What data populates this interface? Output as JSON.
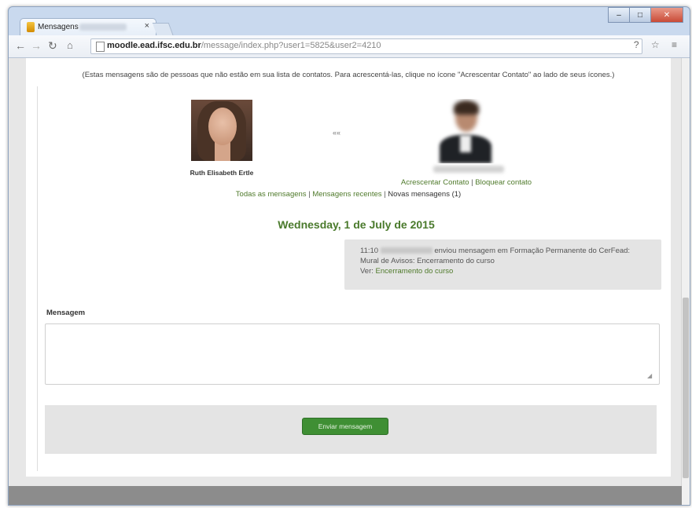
{
  "browser": {
    "tab_title": "Mensagens",
    "tab_close": "×",
    "url_host": "moodle.ead.ifsc.edu.br",
    "url_path": "/message/index.php?user1=5825&user2=4210",
    "window_controls": [
      "–",
      "□",
      "✕"
    ],
    "nav_icons": [
      "arrow-left-icon",
      "arrow-right-icon",
      "reload-icon",
      "home-icon"
    ],
    "toolbar_right": "? ☆ ≡"
  },
  "page": {
    "notice": "(Estas mensagens são de pessoas que não estão em sua lista de contatos. Para acrescentá-las, clique no ícone \"Acrescentar Contato\" ao lado de seus ícones.)",
    "user_left_name": "Ruth Elisabeth Ertle",
    "arrows": "««",
    "contact_actions": {
      "add": "Acrescentar Contato",
      "separator": " | ",
      "block": "Bloquear contato"
    },
    "message_filters": {
      "all": "Todas as mensagens",
      "recent": "Mensagens recentes",
      "new": "Novas mensagens (1)",
      "separator": " | "
    },
    "date_heading": "Wednesday, 1 de July de 2015",
    "message": {
      "time": "11:10",
      "text_after_name": "enviou mensagem em Formação Permanente do CerFead: Mural de Avisos: Encerramento do curso",
      "link_prefix": "Ver: ",
      "link_text": "Encerramento do curso"
    },
    "compose": {
      "label": "Mensagem",
      "value": "",
      "send_button": "Enviar mensagem"
    }
  },
  "colors": {
    "accent_green": "#4a7a2c",
    "button_green": "#3f8f34"
  }
}
